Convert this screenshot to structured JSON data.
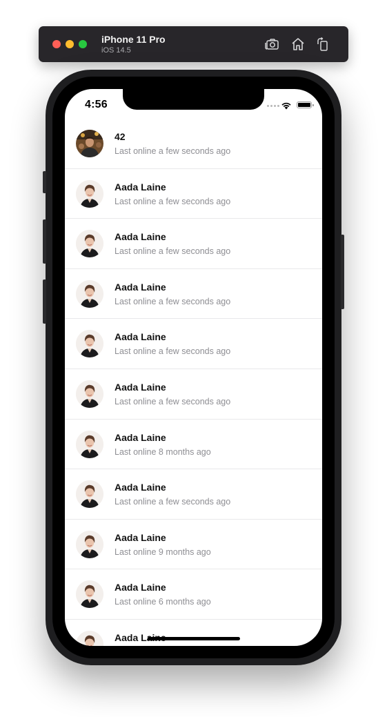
{
  "simulator": {
    "device_name": "iPhone 11 Pro",
    "os_version": "iOS 14.5",
    "icons": [
      "screenshot-icon",
      "home-icon",
      "rotate-icon"
    ]
  },
  "status_bar": {
    "time": "4:56",
    "icons": [
      "signal-icon",
      "wifi-icon",
      "battery-icon"
    ]
  },
  "contacts": [
    {
      "name": "42",
      "status": "Last online a few seconds ago",
      "avatar": "group-photo"
    },
    {
      "name": "Aada Laine",
      "status": "Last online a few seconds ago",
      "avatar": "woman-portrait"
    },
    {
      "name": "Aada Laine",
      "status": "Last online a few seconds ago",
      "avatar": "woman-portrait"
    },
    {
      "name": "Aada Laine",
      "status": "Last online a few seconds ago",
      "avatar": "woman-portrait"
    },
    {
      "name": "Aada Laine",
      "status": "Last online a few seconds ago",
      "avatar": "woman-portrait"
    },
    {
      "name": "Aada Laine",
      "status": "Last online a few seconds ago",
      "avatar": "woman-portrait"
    },
    {
      "name": "Aada Laine",
      "status": "Last online 8 months ago",
      "avatar": "woman-portrait"
    },
    {
      "name": "Aada Laine",
      "status": "Last online a few seconds ago",
      "avatar": "woman-portrait"
    },
    {
      "name": "Aada Laine",
      "status": "Last online 9 months ago",
      "avatar": "woman-portrait"
    },
    {
      "name": "Aada Laine",
      "status": "Last online 6 months ago",
      "avatar": "woman-portrait"
    },
    {
      "name": "Aada Laine",
      "status": "",
      "avatar": "woman-portrait"
    }
  ],
  "colors": {
    "toolbar_bg": "#28262a",
    "close": "#fe5f57",
    "minimize": "#febc2e",
    "zoom": "#28c840",
    "secondary_text": "#8e8e93",
    "separator": "#e8e8ea"
  }
}
